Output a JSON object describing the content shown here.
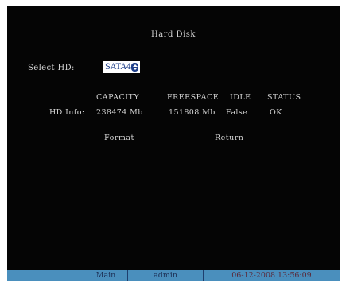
{
  "dialog": {
    "title": "Hard Disk"
  },
  "select": {
    "label": "Select HD:",
    "value": "SATA4"
  },
  "table": {
    "columns": [
      "CAPACITY",
      "FREESPACE",
      "IDLE",
      "STATUS"
    ],
    "row_label": "HD Info:",
    "values": [
      "238474 Mb",
      "151808 Mb",
      "False",
      "OK"
    ]
  },
  "buttons": {
    "format": "Format",
    "return": "Return"
  },
  "statusbar": {
    "menu": "Main",
    "user": "admin",
    "datetime": "06-12-2008 13:56:09"
  },
  "colors": {
    "background": "#050505",
    "text": "#d6d6d6",
    "statusbar": "#4a8fbd",
    "select_text": "#1f3f8a"
  }
}
